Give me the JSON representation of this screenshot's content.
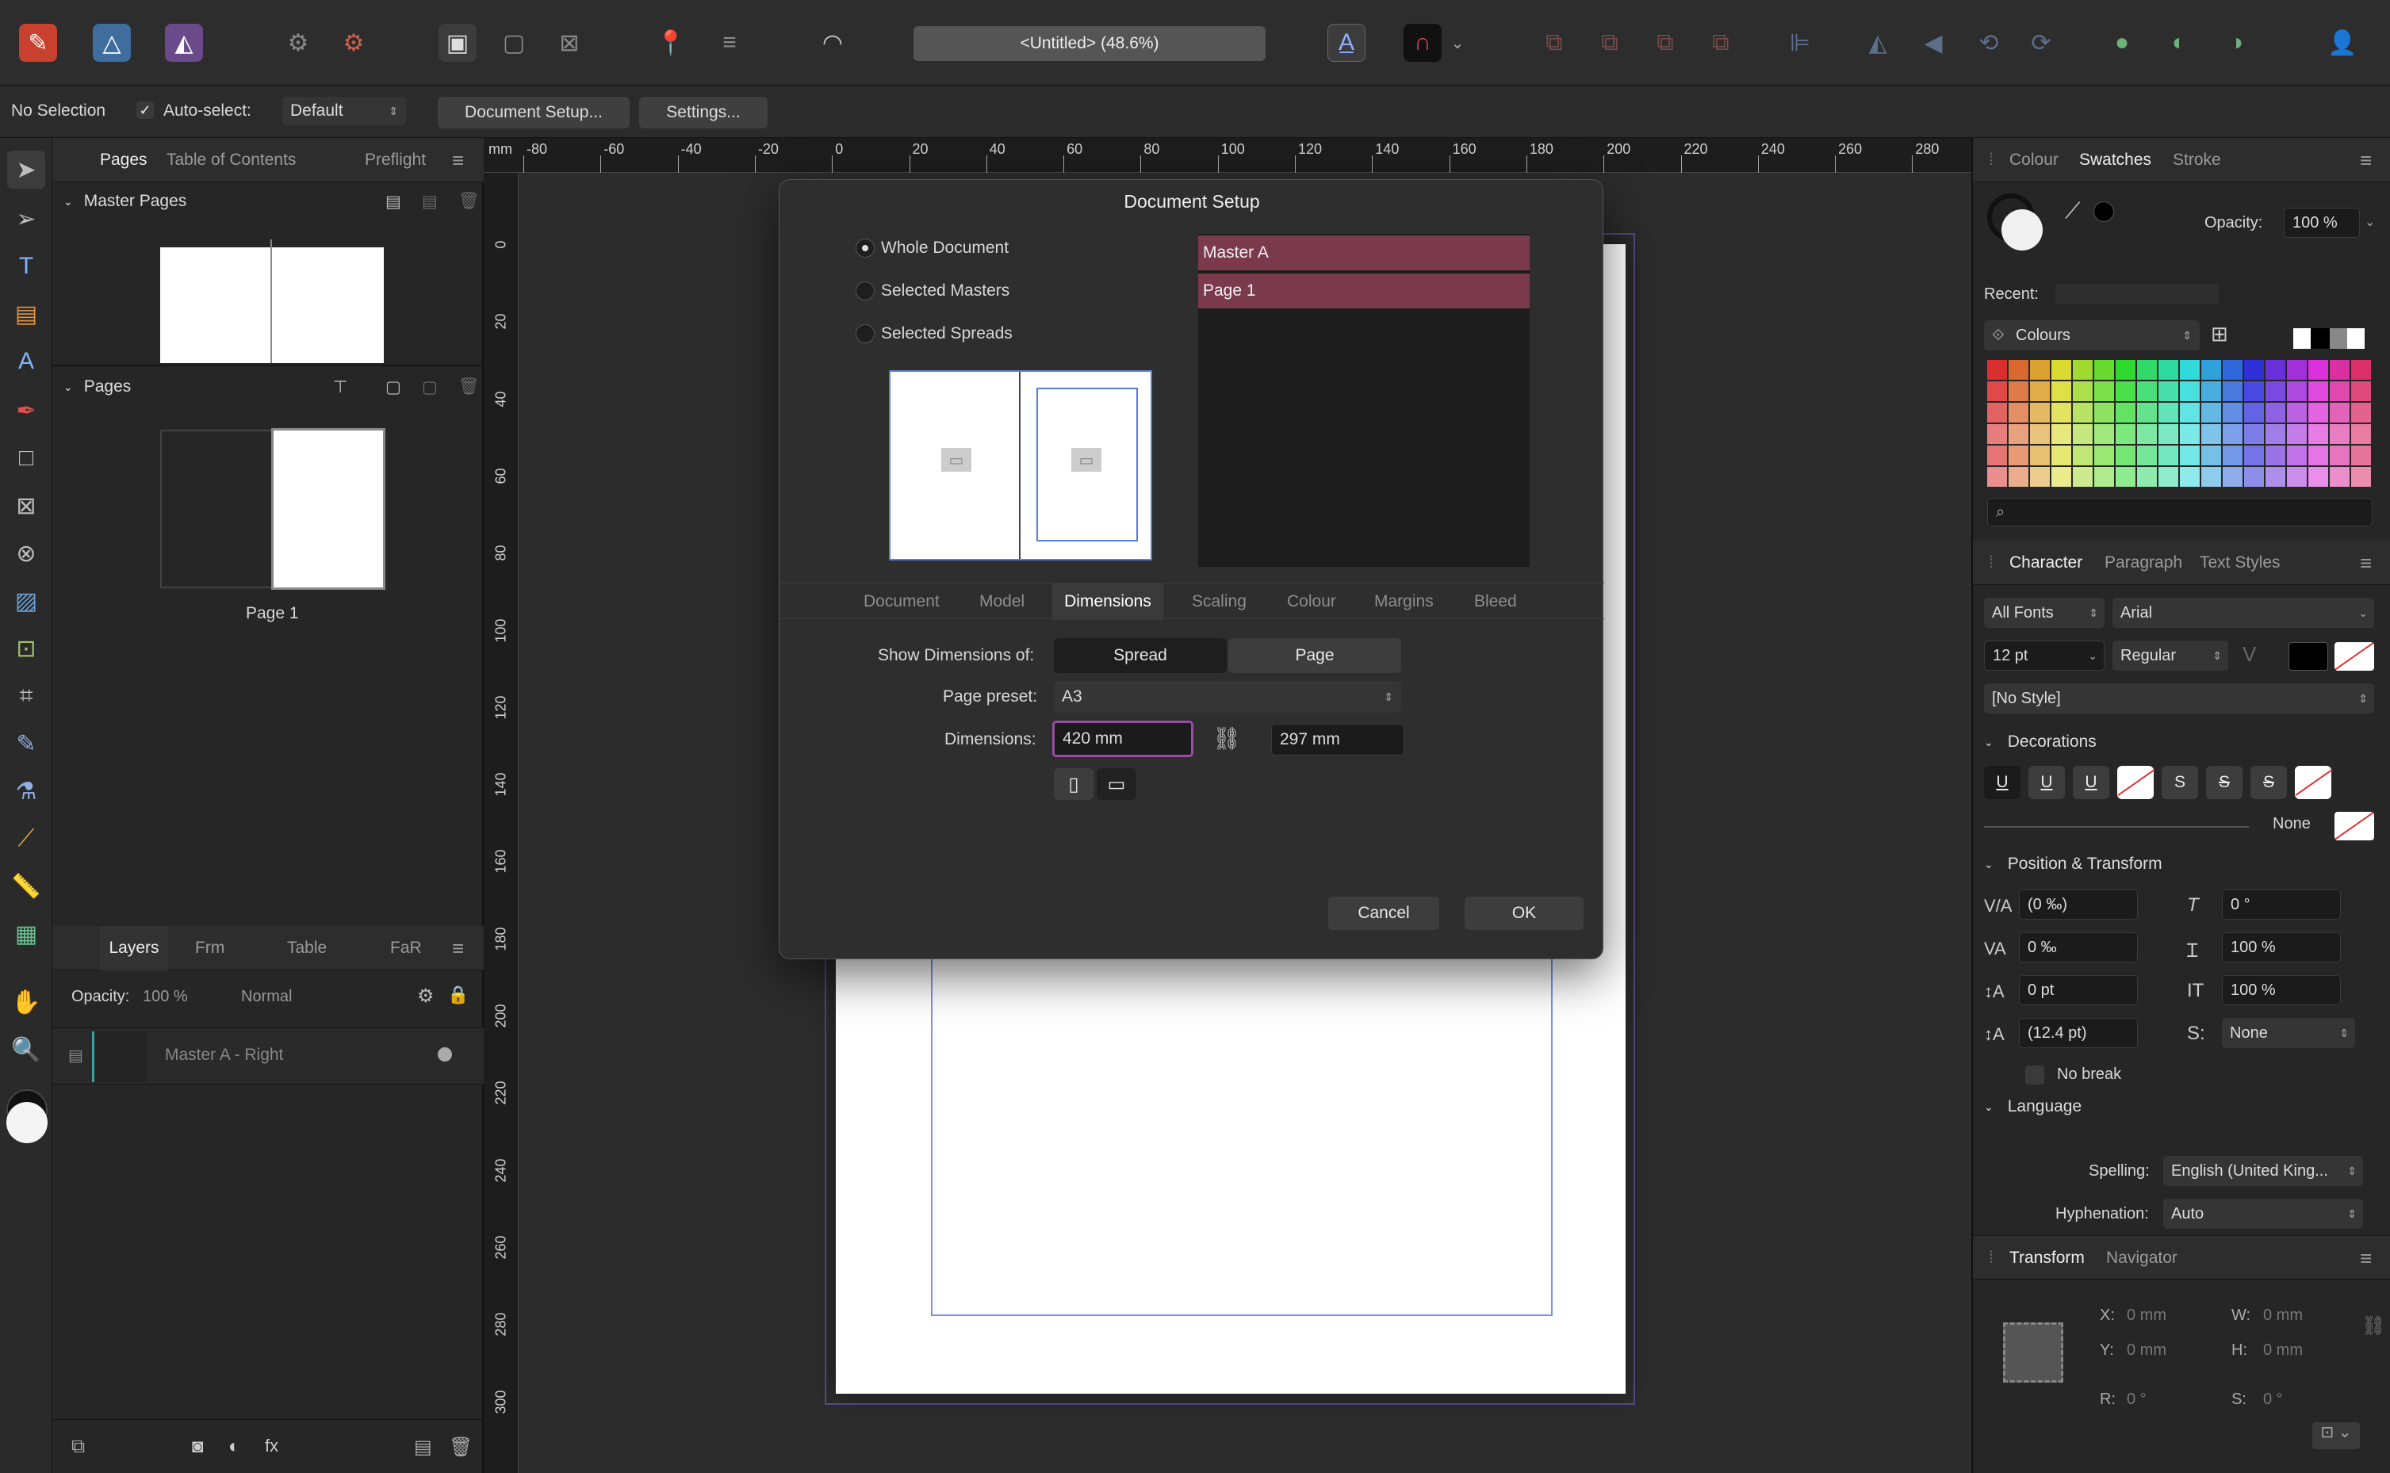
{
  "toolbar": {
    "doc_title": "<Untitled> (48.6%)"
  },
  "context_bar": {
    "selection": "No Selection",
    "autoselect_label": "Auto-select:",
    "autoselect_value": "Default",
    "doc_setup_button": "Document Setup...",
    "settings_button": "Settings..."
  },
  "left_panel": {
    "tabs": [
      "Pages",
      "Table of Contents",
      "Preflight"
    ],
    "master_pages_label": "Master Pages",
    "pages_label": "Pages",
    "page_caption": "Page 1",
    "layer_tabs": [
      "Layers",
      "Frm",
      "Table",
      "FaR"
    ],
    "opacity_label": "Opacity:",
    "opacity_value": "100 %",
    "blend_mode": "Normal",
    "layer_name": "Master A - Right"
  },
  "ruler": {
    "unit": "mm",
    "h_labels": [
      "-80",
      "-60",
      "-40",
      "-20",
      "0",
      "20",
      "40",
      "60",
      "80",
      "100",
      "120",
      "140",
      "160",
      "180",
      "200",
      "220",
      "240",
      "260",
      "280"
    ],
    "v_labels": [
      "0",
      "20",
      "40",
      "60",
      "80",
      "100",
      "120",
      "140",
      "160",
      "180",
      "200",
      "220",
      "240",
      "260",
      "280",
      "300"
    ]
  },
  "dialog": {
    "title": "Document Setup",
    "scope_options": [
      "Whole Document",
      "Selected Masters",
      "Selected Spreads"
    ],
    "selected_scope": 0,
    "list_items": [
      "Master A",
      "Page 1"
    ],
    "tabs": [
      "Document",
      "Model",
      "Dimensions",
      "Scaling",
      "Colour",
      "Margins",
      "Bleed"
    ],
    "active_tab": 2,
    "show_dims_label": "Show Dimensions of:",
    "show_dims_options": [
      "Spread",
      "Page"
    ],
    "preset_label": "Page preset:",
    "preset_value": "A3",
    "dims_label": "Dimensions:",
    "width_value": "420 mm",
    "height_value": "297 mm",
    "cancel": "Cancel",
    "ok": "OK"
  },
  "right_panel": {
    "colour_tabs": [
      "Colour",
      "Swatches",
      "Stroke"
    ],
    "opacity_label": "Opacity:",
    "opacity_value": "100 %",
    "recent_label": "Recent:",
    "palette_name": "Colours",
    "char_tabs": [
      "Character",
      "Paragraph",
      "Text Styles"
    ],
    "font_collection": "All Fonts",
    "font_family": "Arial",
    "font_size": "12 pt",
    "font_weight": "Regular",
    "style": "[No Style]",
    "decorations_label": "Decorations",
    "decoration_none": "None",
    "pos_transform_label": "Position & Transform",
    "kerning": "(0 ‰)",
    "shear": "0 °",
    "tracking": "0 ‰",
    "vscale": "100 %",
    "baseline": "0 pt",
    "hscale": "100 %",
    "leading": "(12.4 pt)",
    "leading_mode": "None",
    "no_break": "No break",
    "language_label": "Language",
    "spelling_label": "Spelling:",
    "spelling_value": "English (United King...",
    "hyphenation_label": "Hyphenation:",
    "hyphenation_value": "Auto",
    "transform_tabs": [
      "Transform",
      "Navigator"
    ],
    "x_label": "X:",
    "x_value": "0 mm",
    "y_label": "Y:",
    "y_value": "0 mm",
    "w_label": "W:",
    "w_value": "0 mm",
    "h_label": "H:",
    "h_value": "0 mm",
    "r_label": "R:",
    "r_value": "0 °",
    "s_label": "S:",
    "s_value": "0 °"
  },
  "colors": {
    "accent_selected": "#7a3a4c",
    "input_focus": "#9a4e9f",
    "guide_blue": "#4a6fd0"
  }
}
